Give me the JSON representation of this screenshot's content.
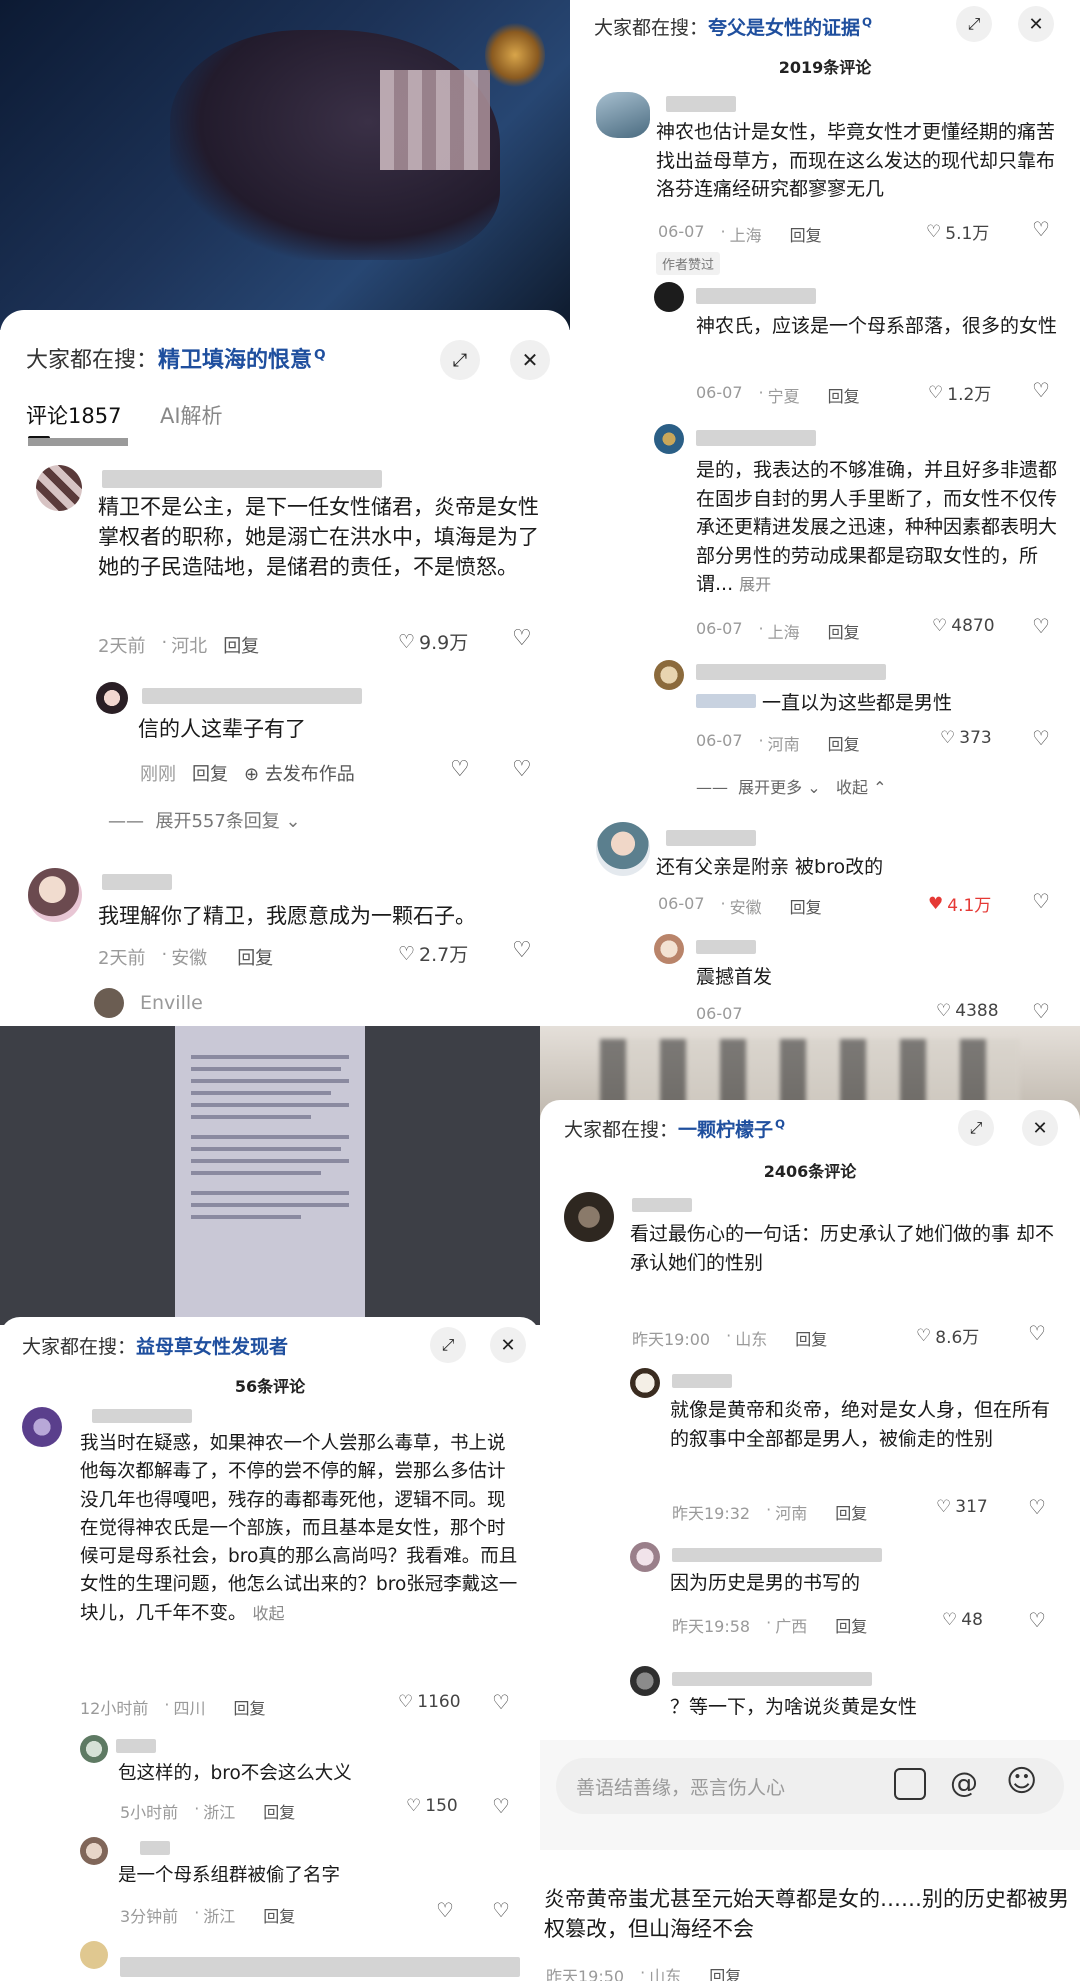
{
  "panel_tl": {
    "search_label": "大家都在搜：",
    "search_query": "精卫填海的恨意",
    "tabs": [
      "评论1857",
      "AI解析"
    ],
    "comments": [
      {
        "text": "精卫不是公主，是下一任女性储君，炎帝是女性掌权者的职称，她是溺亡在洪水中，填海是为了她的子民造陆地，是储君的责任，不是愤怒。",
        "time": "2天前",
        "location": "河北",
        "reply": "回复",
        "likes": "9.9万"
      },
      {
        "text": "信的人这辈子有了",
        "time": "刚刚",
        "reply": "回复",
        "extra": "去发布作品"
      },
      {
        "text": "我理解你了精卫，我愿意成为一颗石子。",
        "time": "2天前",
        "location": "安徽",
        "reply": "回复",
        "likes": "2.7万"
      }
    ],
    "expand": "展开557条回复",
    "next_user": "Enville"
  },
  "panel_tr": {
    "search_label": "大家都在搜：",
    "search_query": "夸父是女性的证据",
    "count": "2019条评论",
    "author_liked": "作者赞过",
    "expand_more": "展开更多",
    "collapse": "收起",
    "comments": [
      {
        "text": "神农也估计是女性，毕竟女性才更懂经期的痛苦找出益母草方，而现在这么发达的现代却只靠布洛芬连痛经研究都寥寥无几",
        "time": "06-07",
        "location": "上海",
        "reply": "回复",
        "likes": "5.1万"
      },
      {
        "text": "神农氏，应该是一个母系部落，很多的女性",
        "time": "06-07",
        "location": "宁夏",
        "reply": "回复",
        "likes": "1.2万"
      },
      {
        "text": "是的，我表达的不够准确，并且好多非遗都在固步自封的男人手里断了，而女性不仅传承还更精进发展之迅速，种种因素都表明大部分男性的劳动成果都是窃取女性的，所谓...",
        "more": "展开",
        "time": "06-07",
        "location": "上海",
        "reply": "回复",
        "likes": "4870"
      },
      {
        "text": "一直以为这些都是男性",
        "time": "06-07",
        "location": "河南",
        "reply": "回复",
        "likes": "373"
      },
      {
        "text": "还有父亲是附亲 被bro改的",
        "time": "06-07",
        "location": "安徽",
        "reply": "回复",
        "likes": "4.1万"
      },
      {
        "text": "震撼首发",
        "time": "06-07",
        "likes": "4388"
      }
    ],
    "accent_red": "#e53935"
  },
  "panel_bl": {
    "search_label": "大家都在搜：",
    "search_query": "益母草女性发现者",
    "count": "56条评论",
    "comments": [
      {
        "text": "我当时在疑惑，如果神农一个人尝那么毒草，书上说他每次都解毒了，不停的尝不停的解，尝那么多估计没几年也得嘎吧，残存的毒都毒死他，逻辑不同。现在觉得神农氏是一个部族，而且基本是女性，那个时候可是母系社会，bro真的那么高尚吗？我看难。而且女性的生理问题，他怎么试出来的？bro张冠李戴这一块儿，几千年不变。",
        "collapse": "收起",
        "time": "12小时前",
        "location": "四川",
        "reply": "回复",
        "likes": "1160"
      },
      {
        "text": "包这样的，bro不会这么大义",
        "time": "5小时前",
        "location": "浙江",
        "reply": "回复",
        "likes": "150"
      },
      {
        "text": "是一个母系组群被偷了名字",
        "time": "3分钟前",
        "location": "浙江",
        "reply": "回复"
      }
    ]
  },
  "panel_br": {
    "search_label": "大家都在搜：",
    "search_query": "一颗柠檬子",
    "count": "2406条评论",
    "comments": [
      {
        "text": "看过最伤心的一句话：历史承认了她们做的事 却不承认她们的性别",
        "time": "昨天19:00",
        "location": "山东",
        "reply": "回复",
        "likes": "8.6万"
      },
      {
        "text": "就像是黄帝和炎帝，绝对是女人身，但在所有的叙事中全部都是男人，被偷走的性别",
        "time": "昨天19:32",
        "location": "河南",
        "reply": "回复",
        "likes": "317"
      },
      {
        "text": "因为历史是男的书写的",
        "time": "昨天19:58",
        "location": "广西",
        "reply": "回复",
        "likes": "48"
      },
      {
        "text": "？等一下，为啥说炎黄是女性"
      }
    ],
    "input_placeholder": "善语结善缘，恶言伤人心",
    "bottom_text": "炎帝黄帝蚩尤甚至元始天尊都是女的……别的历史都被男权篡改，但山海经不会",
    "bottom_time": "昨天19:50",
    "bottom_location": "山东",
    "bottom_reply": "回复"
  }
}
